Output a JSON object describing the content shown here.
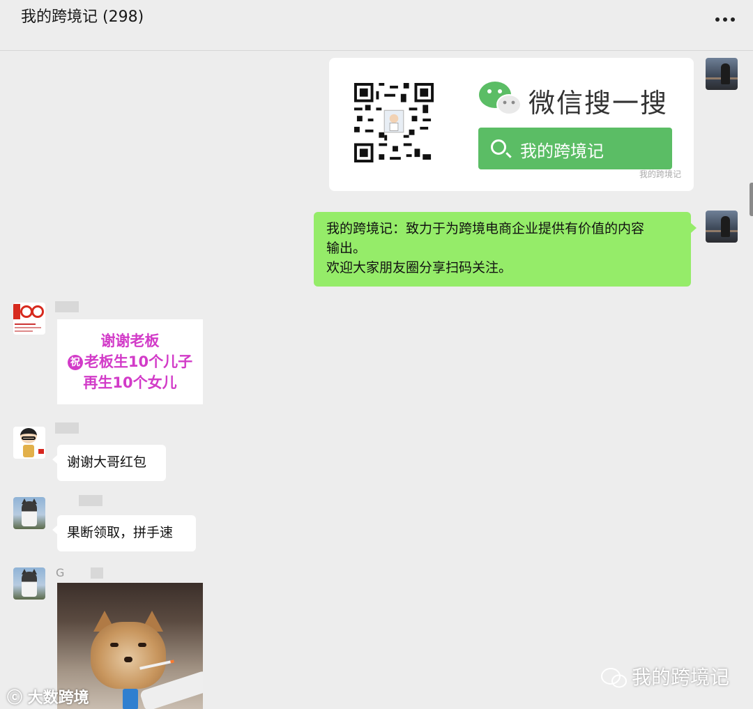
{
  "header": {
    "title": "我的跨境记 (298)",
    "more_icon": "more-horizontal-icon"
  },
  "messages": {
    "card": {
      "search_brand": "微信搜一搜",
      "search_query": "我的跨境记",
      "card_watermark": "我的跨境记"
    },
    "text_out": {
      "line1": "我的跨境记：致力于为跨境电商企业提供有价值的内容",
      "line2": "输出。",
      "line3": "欢迎大家朋友圈分享扫码关注。"
    },
    "poster": {
      "line1": "谢谢老板",
      "zhu": "祝",
      "line2": "老板生10个儿子",
      "line3": "再生10个女儿"
    },
    "msg_thanks": "谢谢大哥红包",
    "msg_fast": "果断领取，拼手速",
    "sender_initial": "G"
  },
  "watermarks": {
    "bottom_left": "大数跨境",
    "bottom_right": "我的跨境记"
  },
  "colors": {
    "background": "#ededed",
    "out_bubble": "#95ec69",
    "wechat_green": "#5bbd65",
    "poster_text": "#d23bc8"
  }
}
